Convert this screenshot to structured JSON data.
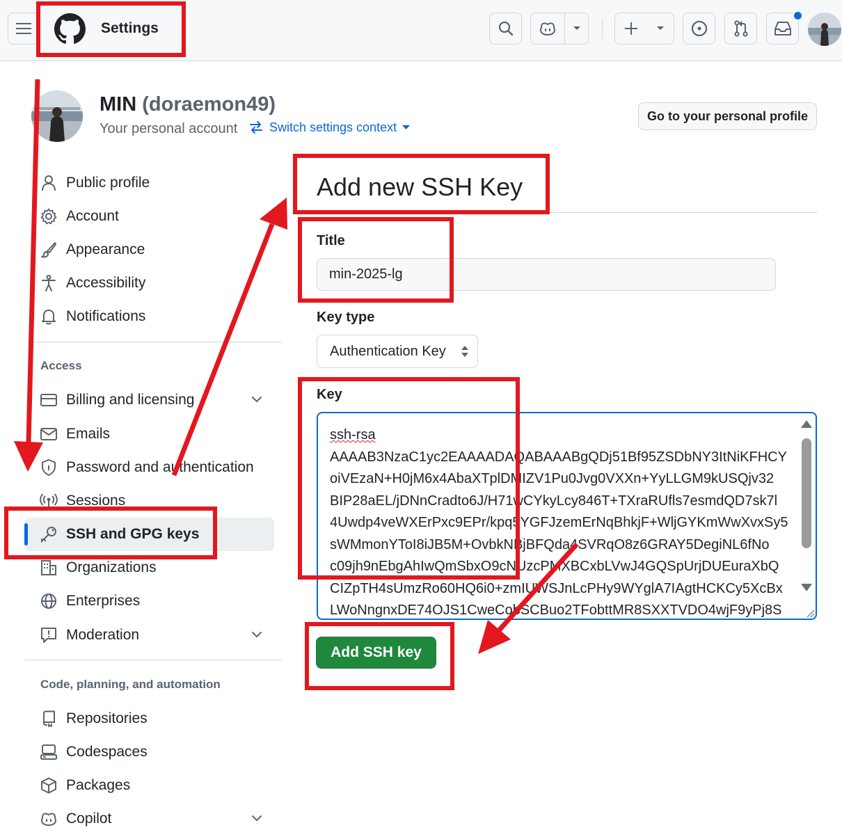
{
  "header": {
    "menu_icon": "hamburger-icon",
    "logo_icon": "github-mark-icon",
    "context_title": "Settings",
    "buttons": [
      "search-icon",
      "copilot-icon",
      "plus-icon",
      "issues-icon",
      "pull-requests-icon",
      "inbox-icon"
    ],
    "notification_indicator": true
  },
  "profile": {
    "name": "MIN",
    "login": "(doraemon49)",
    "account_type": "Your personal account",
    "switch_context": "Switch settings context",
    "go_profile_button": "Go to your personal profile"
  },
  "sidebar": {
    "items_top": [
      {
        "label": "Public profile",
        "icon": "person-icon"
      },
      {
        "label": "Account",
        "icon": "gear-icon"
      },
      {
        "label": "Appearance",
        "icon": "paintbrush-icon"
      },
      {
        "label": "Accessibility",
        "icon": "accessibility-icon"
      },
      {
        "label": "Notifications",
        "icon": "bell-icon"
      }
    ],
    "section_access": "Access",
    "items_access": [
      {
        "label": "Billing and licensing",
        "icon": "credit-card-icon",
        "expandable": true
      },
      {
        "label": "Emails",
        "icon": "mail-icon"
      },
      {
        "label": "Password and authentication",
        "icon": "shield-lock-icon"
      },
      {
        "label": "Sessions",
        "icon": "broadcast-icon"
      },
      {
        "label": "SSH and GPG keys",
        "icon": "key-icon",
        "active": true
      },
      {
        "label": "Organizations",
        "icon": "organization-icon"
      },
      {
        "label": "Enterprises",
        "icon": "globe-icon"
      },
      {
        "label": "Moderation",
        "icon": "report-icon",
        "expandable": true
      }
    ],
    "section_code": "Code, planning, and automation",
    "items_code": [
      {
        "label": "Repositories",
        "icon": "repo-icon"
      },
      {
        "label": "Codespaces",
        "icon": "codespaces-icon"
      },
      {
        "label": "Packages",
        "icon": "package-icon"
      },
      {
        "label": "Copilot",
        "icon": "copilot-icon",
        "expandable": true
      }
    ]
  },
  "form": {
    "page_title": "Add new SSH Key",
    "title_label": "Title",
    "title_value": "min-2025-lg",
    "key_type_label": "Key type",
    "key_type_value": "Authentication Key",
    "key_label": "Key",
    "key_first_line": "ssh-rsa",
    "key_lines": [
      "AAAAB3NzaC1yc2EAAAADAQABAAABgQDj51Bf95ZSDbNY3ItNiKFHCY",
      "oiVEzaN+H0jM6x4AbaXTplDMIZV1Pu0Jvg0VXXn+YyLLGM9kUSQjv32",
      "BIP28aEL/jDNnCradto6J/H71wCYkyLcy846T+TXraRUfls7esmdQD7sk7l",
      "4Uwdp4veWXErPxc9EPr/kpq5YGFJzemErNqBhkjF+WljGYKmWwXvxSy5",
      "sWMmonYToI8iJB5M+OvbkNBjBFQda4SVRqO8z6GRAY5DegiNL6fNo",
      "c09jh9nEbgAhIwQmSbxO9cNUzcPMXBCxbLVwJ4GQSpUrjDUEuraXbQ",
      "CIZpTH4sUmzRo60HQ6i0+zmIUWSJnLcPHy9WYglA7IAgtHCKCy5XcBx",
      "LWoNngnxDE74OJS1CweCobSCBuo2TFobttMR8SXXTVDO4wjF9yPj8S"
    ],
    "submit_label": "Add SSH key"
  },
  "annotation_color": "#e3171e"
}
